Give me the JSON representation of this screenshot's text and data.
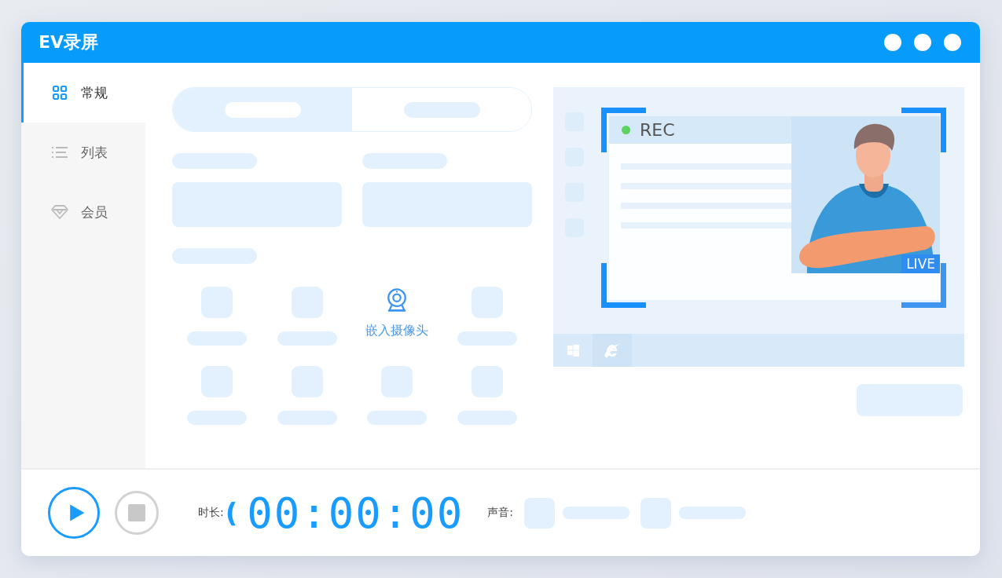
{
  "window": {
    "title": "EV录屏"
  },
  "sidebar": {
    "items": [
      {
        "label": "常规",
        "kind": "grid",
        "selected": true
      },
      {
        "label": "列表",
        "kind": "list",
        "selected": false
      },
      {
        "label": "会员",
        "kind": "diamond",
        "selected": false
      }
    ]
  },
  "feature_grid": {
    "items": [
      {
        "kind": "placeholder"
      },
      {
        "kind": "placeholder"
      },
      {
        "kind": "camera",
        "label": "嵌入摄像头"
      },
      {
        "kind": "placeholder"
      },
      {
        "kind": "placeholder"
      },
      {
        "kind": "placeholder"
      },
      {
        "kind": "placeholder"
      },
      {
        "kind": "placeholder"
      }
    ]
  },
  "preview": {
    "rec_label": "REC",
    "live_badge": "LIVE"
  },
  "bottom_bar": {
    "duration_label": "时长:",
    "bracket": "(",
    "duration": "00:00:00",
    "sound_label": "声音:"
  }
}
